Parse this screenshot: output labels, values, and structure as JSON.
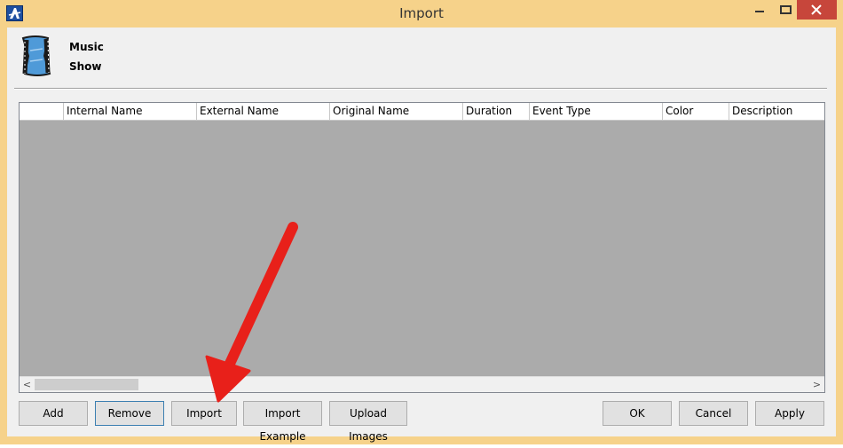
{
  "window": {
    "title": "Import"
  },
  "header": {
    "line1": "Music",
    "line2": "Show"
  },
  "table": {
    "columns": [
      "",
      "Internal Name",
      "External Name",
      "Original Name",
      "Duration",
      "Event Type",
      "Color",
      "Description"
    ],
    "rows": []
  },
  "scrollbar": {
    "left_arrow": "<",
    "right_arrow": ">"
  },
  "buttons": {
    "add": "Add",
    "remove": "Remove",
    "import": "Import",
    "import_example": "Import Example",
    "upload_images": "Upload Images",
    "ok": "OK",
    "cancel": "Cancel",
    "apply": "Apply"
  },
  "colors": {
    "title_bar": "#f6d28a",
    "close_button": "#c7463b",
    "grid_background": "#ababab",
    "annotation_arrow": "#e8201a"
  },
  "icons": [
    "app-logo-icon",
    "minimize-icon",
    "maximize-icon",
    "close-icon",
    "film-strip-icon",
    "scroll-left-icon",
    "scroll-right-icon"
  ]
}
